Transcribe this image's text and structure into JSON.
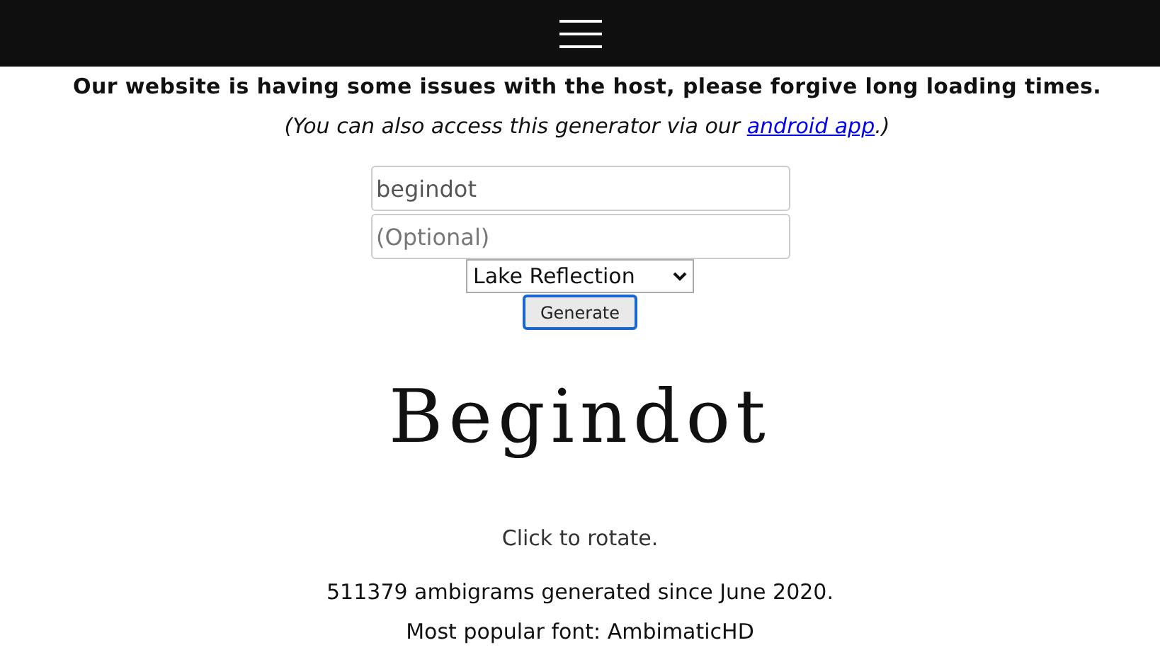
{
  "notice": "Our website is having some issues with the host, please forgive long loading times.",
  "app_note": {
    "before": "(You can also access this generator via our ",
    "link": "android app",
    "after": ".)"
  },
  "form": {
    "word_field": {
      "value": "begindot"
    },
    "second_field": {
      "placeholder": "(Optional)"
    },
    "font_select": {
      "value": "Lake Reflection"
    },
    "button": "Generate"
  },
  "ambigram_text": "Begindot",
  "rotate_hint": "Click to rotate.",
  "stats": [
    "511379 ambigrams generated since June 2020.",
    "Most popular font: AmbimaticHD"
  ]
}
